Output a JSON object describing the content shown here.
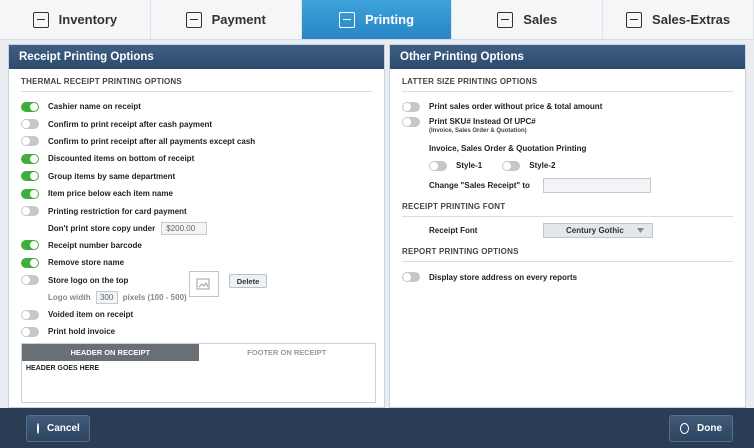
{
  "tabs": [
    {
      "label": "Inventory",
      "icon": "inventory-icon",
      "active": false
    },
    {
      "label": "Payment",
      "icon": "payment-icon",
      "active": false
    },
    {
      "label": "Printing",
      "icon": "printing-icon",
      "active": true
    },
    {
      "label": "Sales",
      "icon": "sales-icon",
      "active": false
    },
    {
      "label": "Sales-Extras",
      "icon": "sales-extras-icon",
      "active": false
    }
  ],
  "left_panel": {
    "title": "Receipt Printing Options",
    "section": "THERMAL RECEIPT PRINTING OPTIONS",
    "options": [
      {
        "label": "Cashier name on receipt",
        "on": true
      },
      {
        "label": "Confirm to print receipt after cash payment",
        "on": false
      },
      {
        "label": "Confirm to print receipt after all payments except cash",
        "on": false
      },
      {
        "label": "Discounted items on bottom of receipt",
        "on": true
      },
      {
        "label": "Group items by same department",
        "on": true
      },
      {
        "label": "Item price below each item name",
        "on": true
      },
      {
        "label": "Printing restriction for card payment",
        "on": false
      }
    ],
    "store_copy_label": "Don't print store copy under",
    "store_copy_value": "$200.00",
    "options2": [
      {
        "label": "Receipt number barcode",
        "on": true
      },
      {
        "label": "Remove store name",
        "on": true
      },
      {
        "label": "Store logo on the top",
        "on": false
      }
    ],
    "logo_width_label": "Logo width",
    "logo_width_value": "300",
    "logo_width_suffix": "pixels (100 - 500)",
    "delete_label": "Delete",
    "options3": [
      {
        "label": "Voided item on receipt",
        "on": false
      },
      {
        "label": "Print hold invoice",
        "on": false
      }
    ],
    "header_tab": "HEADER ON RECEIPT",
    "footer_tab": "FOOTER ON RECEIPT",
    "header_text": "HEADER GOES HERE"
  },
  "right_panel": {
    "title": "Other Printing Options",
    "section1": "LATTER SIZE PRINTING OPTIONS",
    "opt_sales_order": "Print sales order without price & total amount",
    "opt_sku": "Print SKU# Instead Of UPC#",
    "sku_note": "(Invoice, Sales Order & Quotation)",
    "style_label": "Invoice, Sales Order & Quotation Printing",
    "style1": "Style-1",
    "style2": "Style-2",
    "change_label": "Change \"Sales Receipt\" to",
    "change_value": "",
    "section2": "RECEIPT PRINTING FONT",
    "font_label": "Receipt Font",
    "font_value": "Century Gothic",
    "section3": "REPORT PRINTING OPTIONS",
    "opt_store_address": "Display store address on every reports"
  },
  "bottom": {
    "cancel": "Cancel",
    "done": "Done"
  },
  "colors": {
    "accent": "#2786c4",
    "panel_header": "#2d4a6c",
    "toggle_on": "#3fae3f",
    "toggle_off": "#c4c8cd",
    "bottom_bar": "#2a3d55"
  }
}
